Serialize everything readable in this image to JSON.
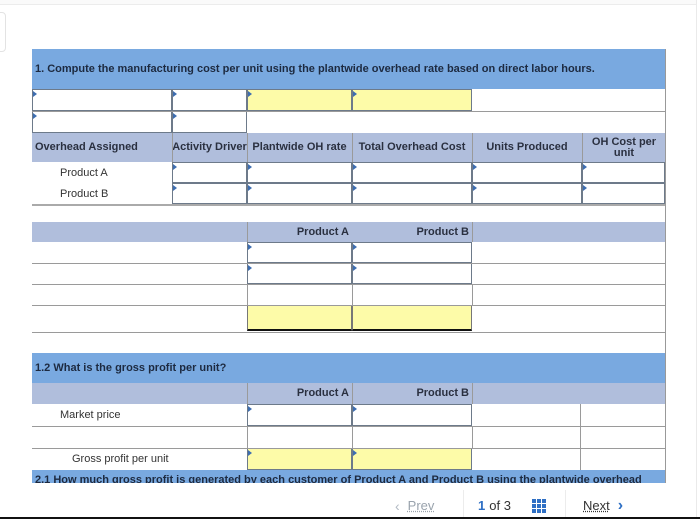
{
  "section1": {
    "title": "1. Compute the manufacturing cost per unit using the plantwide overhead rate based on direct labor hours.",
    "table_headers": [
      "Overhead Assigned",
      "Activity Driver",
      "Plantwide OH rate",
      "Total Overhead Cost",
      "Units Produced",
      "OH Cost per unit"
    ],
    "rows": [
      {
        "label": "Product A"
      },
      {
        "label": "Product B"
      }
    ],
    "summary_headers": [
      "",
      "Product A",
      "Product B"
    ]
  },
  "section2": {
    "title": "1.2 What is the gross profit per unit?",
    "headers": [
      "",
      "Product A",
      "Product B"
    ],
    "rows": [
      {
        "label": "Market price"
      },
      {
        "label": ""
      },
      {
        "label": "Gross profit per unit"
      }
    ]
  },
  "section3": {
    "title": "2.1 How much gross profit is generated by each customer of Product A and Product B using the plantwide overhead"
  },
  "pagination": {
    "prev_label": "Prev",
    "current": "1",
    "of_label": "of 3",
    "next_label": "Next",
    "accent": "#2e6fc4"
  }
}
